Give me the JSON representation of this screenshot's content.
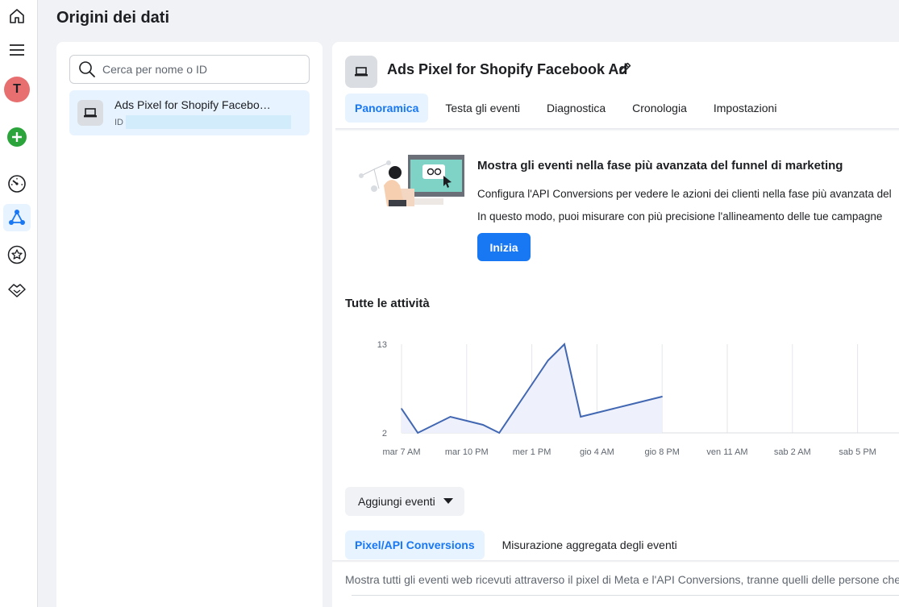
{
  "page": {
    "title": "Origini dei dati"
  },
  "rail": {
    "avatar_letter": "T",
    "items": [
      {
        "icon": "home-icon"
      },
      {
        "icon": "menu-icon"
      },
      {
        "icon": "avatar"
      },
      {
        "icon": "add-circle-icon"
      },
      {
        "icon": "dashboard-gauge-icon"
      },
      {
        "icon": "data-sources-icon",
        "active": true
      },
      {
        "icon": "star-icon"
      },
      {
        "icon": "partner-handshake-icon"
      }
    ]
  },
  "sidebar": {
    "search_placeholder": "Cerca per nome o ID",
    "source": {
      "name": "Ads Pixel for Shopify Facebo…",
      "id_label": "ID"
    }
  },
  "main": {
    "title": "Ads Pixel for Shopify Facebook Ad",
    "tabs": [
      {
        "label": "Panoramica",
        "active": true
      },
      {
        "label": "Testa gli eventi"
      },
      {
        "label": "Diagnostica"
      },
      {
        "label": "Cronologia"
      },
      {
        "label": "Impostazioni"
      }
    ],
    "promo": {
      "title": "Mostra gli eventi nella fase più avanzata del funnel di marketing",
      "line1": "Configura l'API Conversions per vedere le azioni dei clienti nella fase più avanzata del",
      "line2": "In questo modo, puoi misurare con più precisione l'allineamento delle tue campagne",
      "button": "Inizia"
    },
    "activity_title": "Tutte le attività",
    "add_events": "Aggiungi eventi",
    "subtabs": [
      {
        "label": "Pixel/API Conversions",
        "active": true
      },
      {
        "label": "Misurazione aggregata degli eventi"
      }
    ],
    "description": "Mostra tutti gli eventi web ricevuti attraverso il pixel di Meta e l'API Conversions, tranne quelli delle persone che"
  },
  "chart_data": {
    "type": "area",
    "x": [
      "mar 7 AM",
      "",
      "mar 10 PM",
      "",
      "mer 1 PM",
      "",
      "gio 4 AM",
      "",
      "gio 8 PM",
      "",
      "ven 11 AM",
      "",
      "sab 2 AM",
      "",
      "sab 5 PM",
      "",
      ""
    ],
    "x_tick_labels": [
      "mar 7 AM",
      "mar 10 PM",
      "mer 1 PM",
      "gio 4 AM",
      "gio 8 PM",
      "ven 11 AM",
      "sab 2 AM",
      "sab 5 PM"
    ],
    "y_tick_labels": [
      "13",
      "2"
    ],
    "series": [
      {
        "values": [
          5,
          2,
          3,
          4,
          3.5,
          3,
          2,
          5,
          8,
          11,
          13,
          4,
          4.5,
          5,
          5.5,
          6,
          6.5
        ]
      }
    ],
    "ylim": [
      2,
      13
    ],
    "colors": {
      "line": "#4267b2",
      "fill": "#eef1fb"
    },
    "grid": true
  },
  "colors": {
    "accent": "#1877f2",
    "accent_bg": "#e7f3ff",
    "page_bg": "#f0f2f5"
  }
}
